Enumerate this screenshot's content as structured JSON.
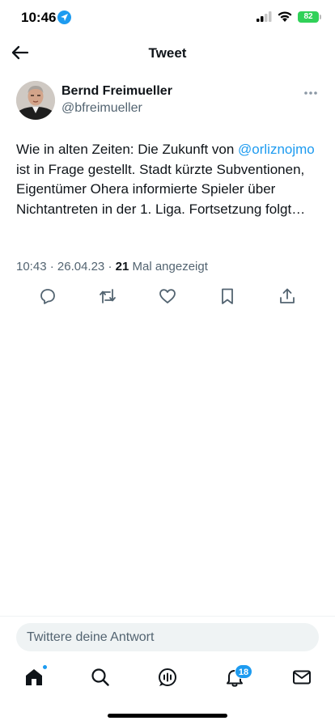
{
  "status_bar": {
    "time": "10:46",
    "battery": "82"
  },
  "header": {
    "title": "Tweet"
  },
  "author": {
    "name": "Bernd Freimueller",
    "handle": "@bfreimueller"
  },
  "tweet": {
    "text_before": "Wie in alten Zeiten: Die Zukunft von ",
    "mention": "@orliznojmo",
    "text_after": " ist in Frage gestellt. Stadt kürzte Subventionen, Eigentümer Ohera informierte Spieler über Nichtantreten in der 1. Liga. Fortsetzung folgt…",
    "time": "10:43",
    "date": "26.04.23",
    "separator": " · ",
    "views_count": "21",
    "views_label": "Mal angezeigt"
  },
  "actions": [
    "reply-icon",
    "retweet-icon",
    "like-icon",
    "bookmark-icon",
    "share-icon"
  ],
  "reply": {
    "placeholder": "Twittere deine Antwort"
  },
  "nav": {
    "items": [
      "home-icon",
      "search-icon",
      "spaces-icon",
      "notifications-icon",
      "messages-icon"
    ],
    "notifications_badge": "18"
  },
  "colors": {
    "accent": "#1d9bf0",
    "text": "#0f1419",
    "secondary_text": "#536471",
    "battery": "#30d158"
  }
}
